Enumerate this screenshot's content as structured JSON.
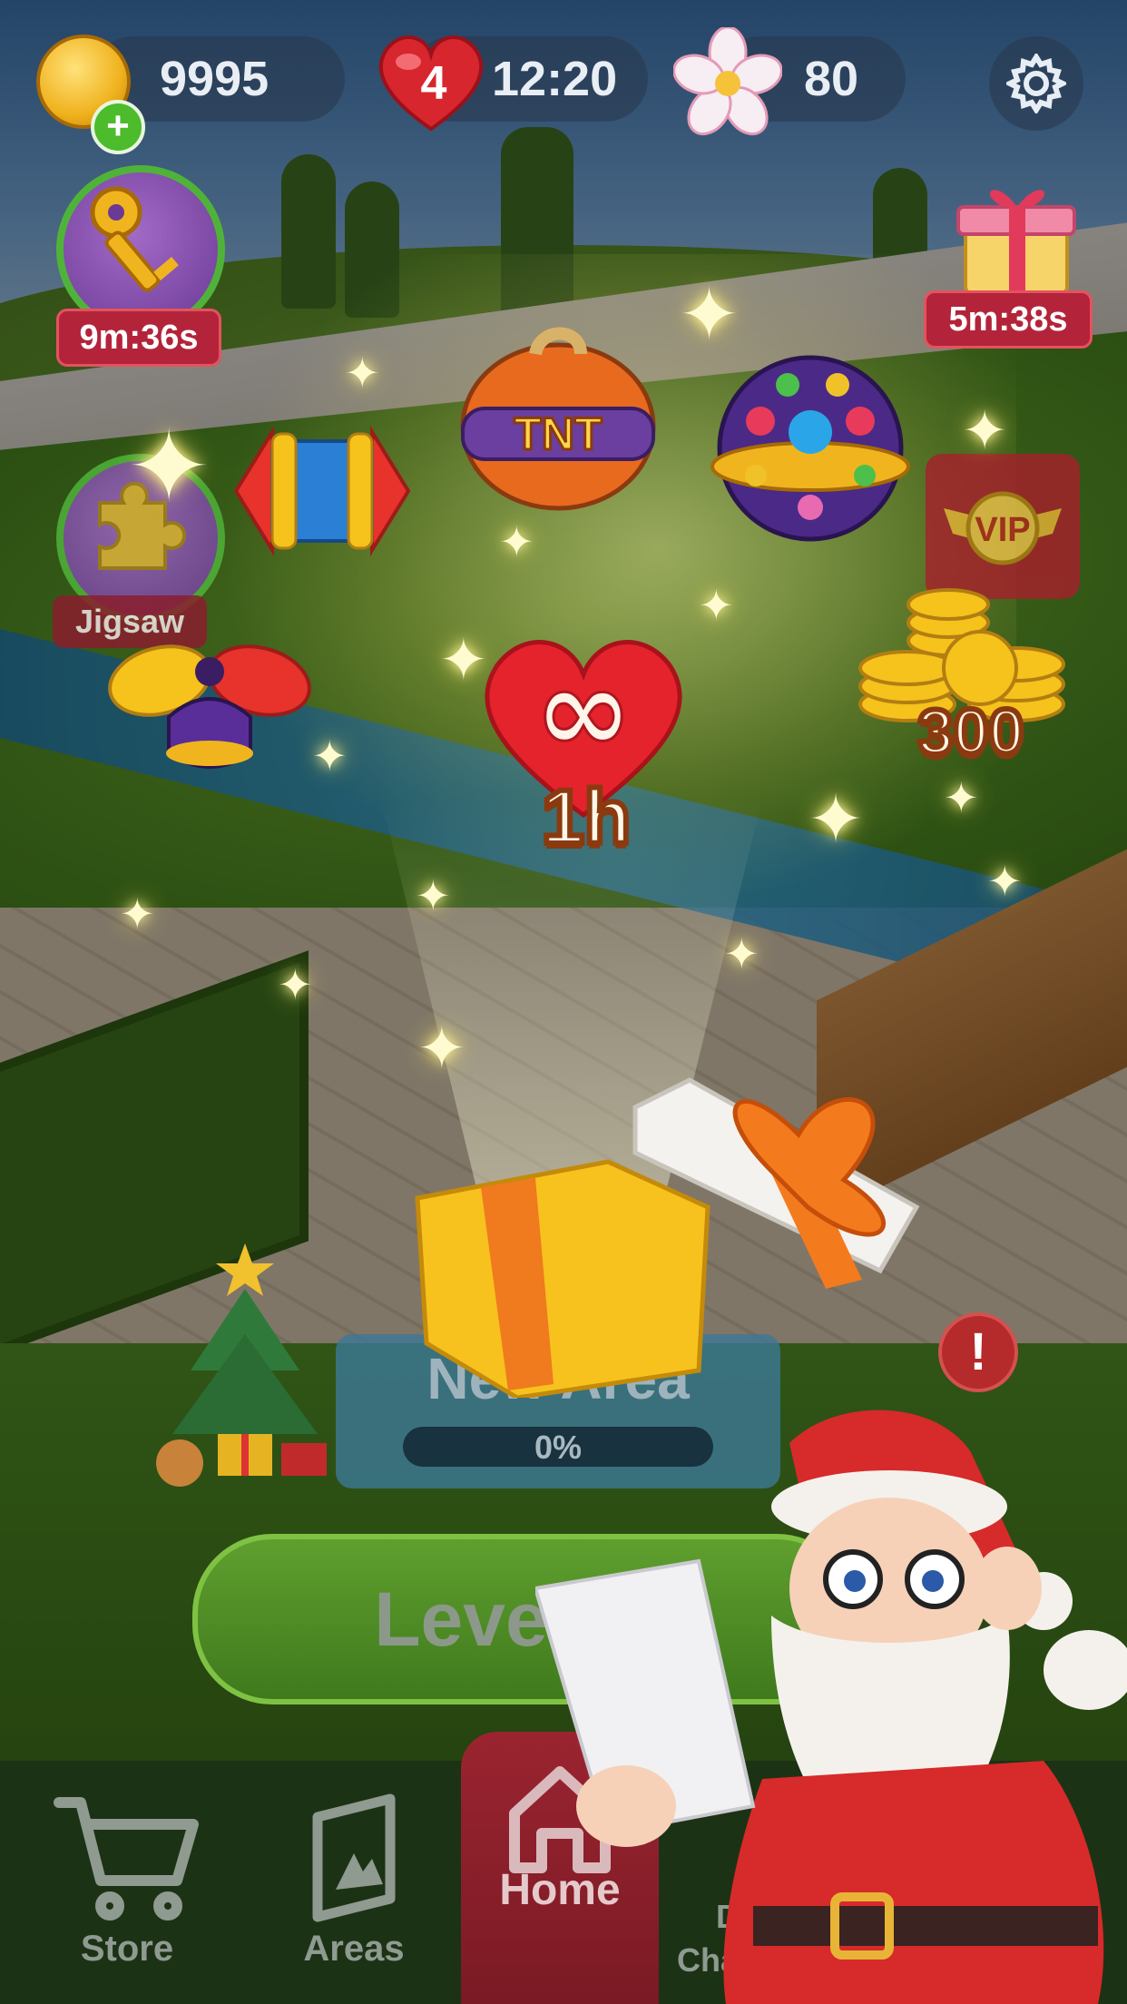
{
  "hud": {
    "coins": "9995",
    "coins_plus": "+",
    "lives": "4",
    "lives_timer": "12:20",
    "flowers": "80"
  },
  "timed_events": {
    "key_event_timer": "9m:36s",
    "gift_event_timer": "5m:38s",
    "jigsaw_label": "Jigsaw"
  },
  "rewards": {
    "items": [
      "rocket-booster",
      "tnt-bomb",
      "disco-ball",
      "vip-badge",
      "propeller-booster",
      "infinite-lives",
      "coin-stack"
    ],
    "infinite_lives_duration": "1h",
    "coin_amount": "300",
    "tnt_label": "TNT",
    "vip_label": "VIP",
    "infinity_symbol": "∞"
  },
  "new_area": {
    "title": "New Area",
    "progress_text": "0%",
    "progress": 0
  },
  "alert": "!",
  "level_button": {
    "label": "Level 15"
  },
  "tabs": [
    {
      "label": "Store",
      "icon": "cart-icon"
    },
    {
      "label": "Areas",
      "icon": "areas-icon"
    },
    {
      "label": "Home",
      "icon": "home-icon"
    },
    {
      "label": "Daily Challenge",
      "icon": "calendar-icon"
    }
  ],
  "colors": {
    "home_tab": "#9a2430",
    "timer_badge": "#b3243a",
    "level_button": "#4f8c24",
    "coin_gold": "#f0b21e",
    "heart_red": "#d7262e"
  }
}
